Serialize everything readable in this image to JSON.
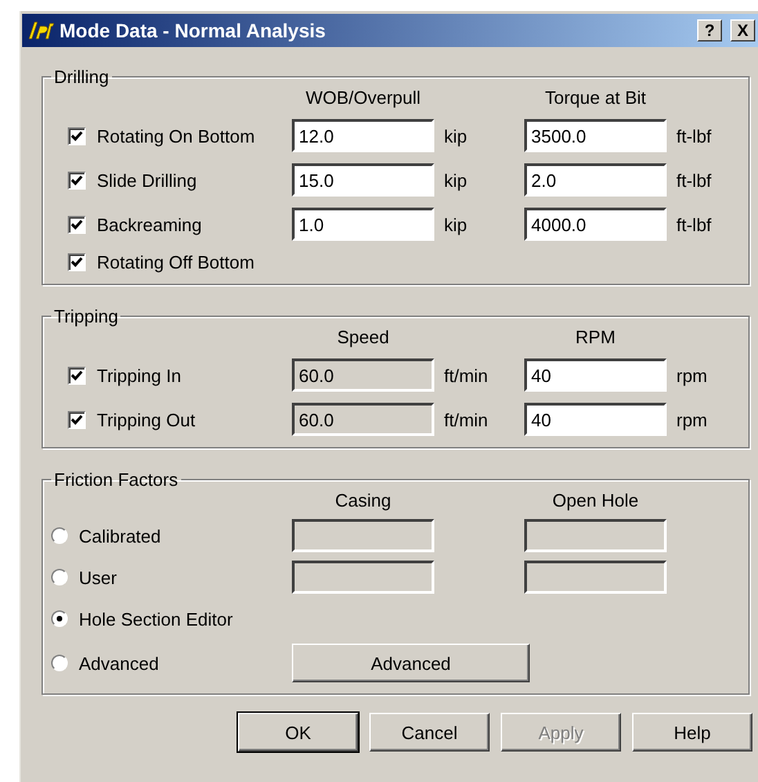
{
  "window": {
    "title": "Mode Data - Normal Analysis",
    "title_buttons": [
      "?",
      "X"
    ]
  },
  "drilling": {
    "title": "Drilling",
    "columns": [
      "WOB/Overpull",
      "Torque at Bit"
    ],
    "rows": [
      {
        "label": "Rotating On Bottom",
        "checked": true,
        "fields": [
          {
            "value": "12.0",
            "unit": "kip",
            "disabled": false
          },
          {
            "value": "3500.0",
            "unit": "ft-lbf",
            "disabled": false
          }
        ]
      },
      {
        "label": "Slide Drilling",
        "checked": true,
        "fields": [
          {
            "value": "15.0",
            "unit": "kip",
            "disabled": false
          },
          {
            "value": "2.0",
            "unit": "ft-lbf",
            "disabled": false
          }
        ]
      },
      {
        "label": "Backreaming",
        "checked": true,
        "fields": [
          {
            "value": "1.0",
            "unit": "kip",
            "disabled": false
          },
          {
            "value": "4000.0",
            "unit": "ft-lbf",
            "disabled": false
          }
        ]
      },
      {
        "label": "Rotating Off Bottom",
        "checked": true
      }
    ]
  },
  "tripping": {
    "title": "Tripping",
    "columns": [
      "Speed",
      "RPM"
    ],
    "rows": [
      {
        "label": "Tripping In",
        "checked": true,
        "fields": [
          {
            "value": "60.0",
            "unit": "ft/min",
            "disabled": true
          },
          {
            "value": "40",
            "unit": "rpm",
            "disabled": false
          }
        ]
      },
      {
        "label": "Tripping Out",
        "checked": true,
        "fields": [
          {
            "value": "60.0",
            "unit": "ft/min",
            "disabled": true
          },
          {
            "value": "40",
            "unit": "rpm",
            "disabled": false
          }
        ]
      }
    ]
  },
  "friction": {
    "title": "Friction Factors",
    "columns": [
      "Casing",
      "Open Hole"
    ],
    "options": [
      {
        "label": "Calibrated",
        "selected": false,
        "kind": "fields",
        "fields": [
          {
            "disabled": true
          },
          {
            "disabled": true
          }
        ]
      },
      {
        "label": "User",
        "selected": false,
        "kind": "fields",
        "fields": [
          {
            "disabled": true
          },
          {
            "disabled": true
          }
        ]
      },
      {
        "label": "Hole Section Editor",
        "selected": true,
        "kind": "plain"
      },
      {
        "label": "Advanced",
        "selected": false,
        "kind": "button",
        "button_label": "Advanced"
      }
    ]
  },
  "buttons": [
    {
      "label": "OK",
      "default": true,
      "disabled": false
    },
    {
      "label": "Cancel",
      "default": false,
      "disabled": false
    },
    {
      "label": "Apply",
      "default": false,
      "disabled": true
    },
    {
      "label": "Help",
      "default": false,
      "disabled": false
    }
  ]
}
